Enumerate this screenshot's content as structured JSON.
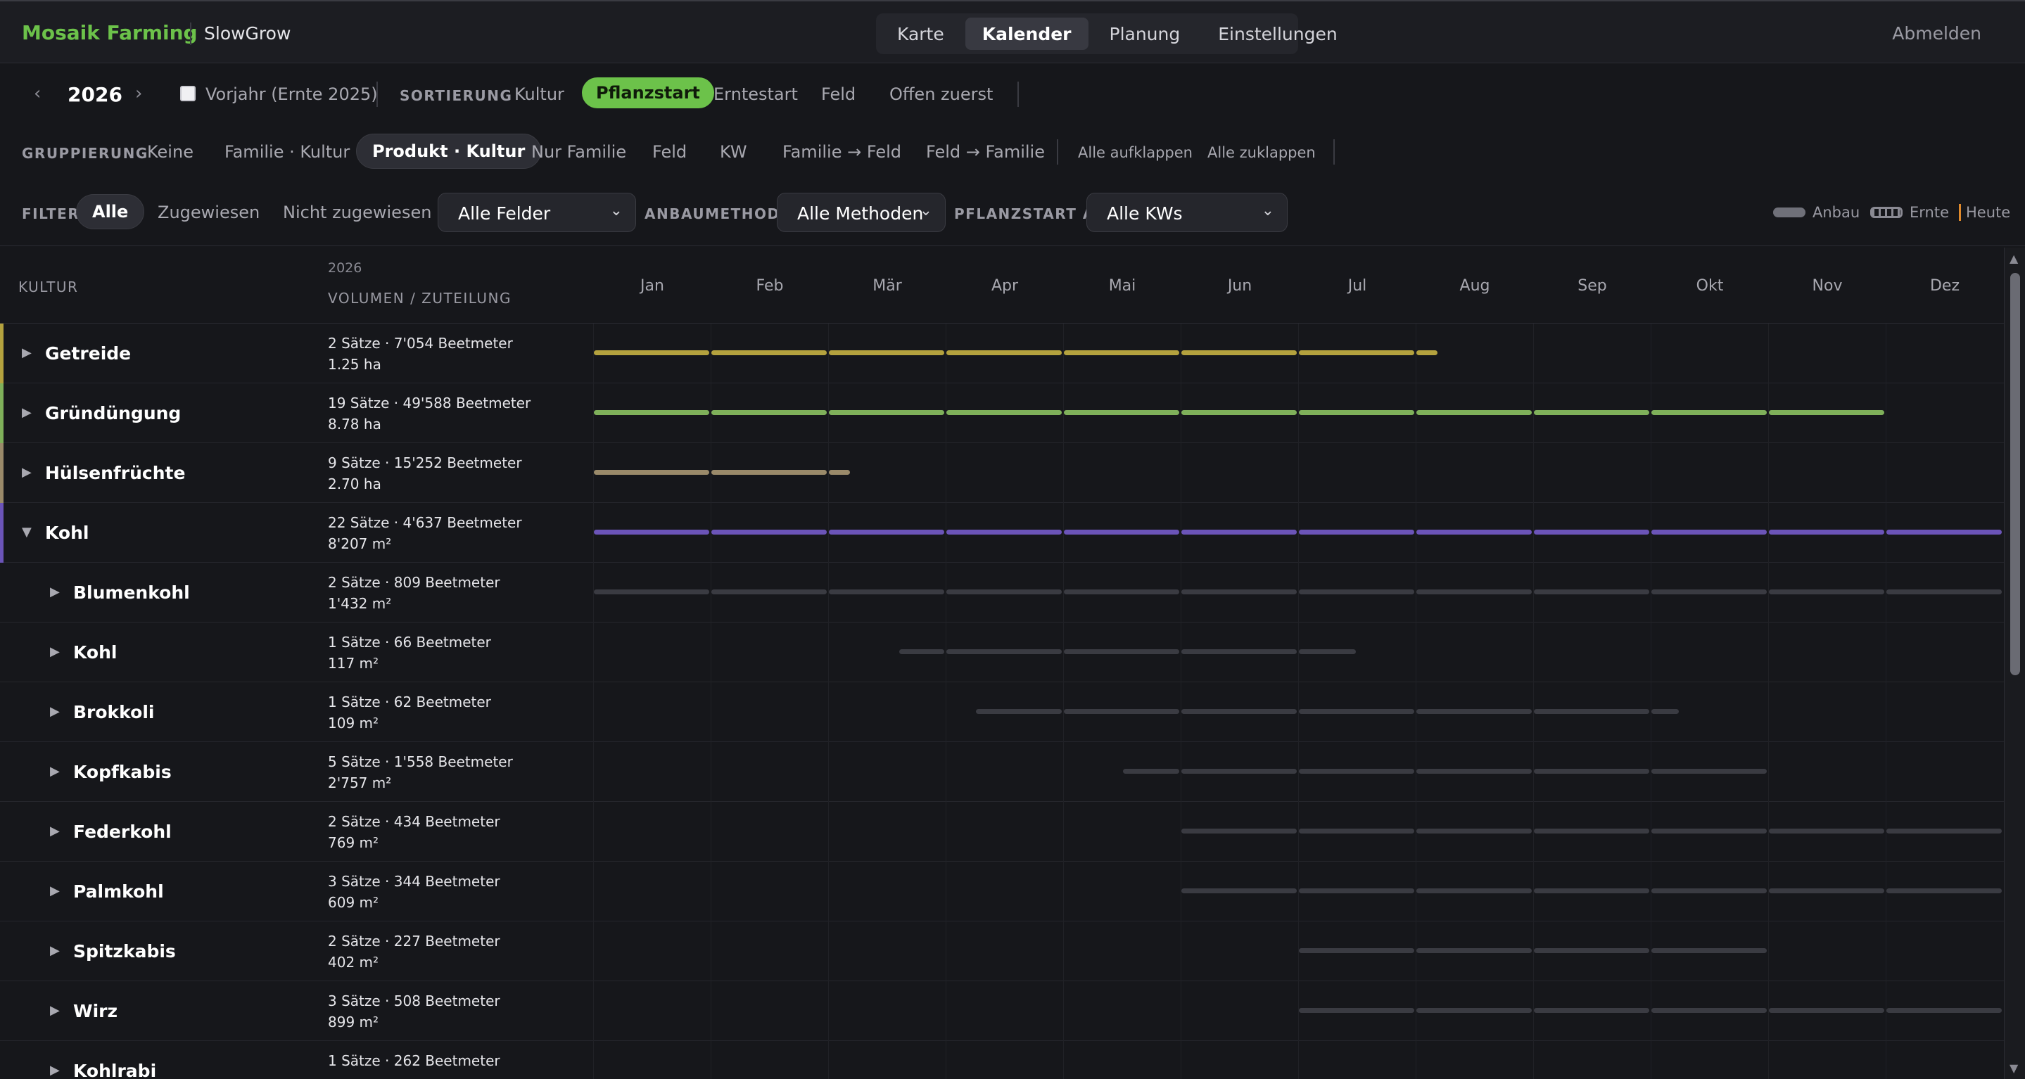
{
  "app": {
    "brand": "Mosaik Farming",
    "farm": "SlowGrow",
    "logout": "Abmelden"
  },
  "nav": {
    "tabs": [
      "Karte",
      "Kalender",
      "Planung",
      "Einstellungen"
    ],
    "active": "Kalender"
  },
  "toolbar": {
    "prev": "‹",
    "year": "2026",
    "next": "›",
    "prev_year_label": "Vorjahr (Ernte 2025)",
    "prev_year_checked": false,
    "sort_label": "SORTIERUNG",
    "sort_options": [
      "Kultur",
      "Pflanzstart",
      "Erntestart",
      "Feld",
      "Offen zuerst"
    ],
    "sort_active": "Pflanzstart",
    "group_label": "GRUPPIERUNG",
    "group_options": [
      "Keine",
      "Familie · Kultur",
      "Produkt · Kultur",
      "Nur Familie",
      "Feld",
      "KW",
      "Familie → Feld",
      "Feld → Familie"
    ],
    "group_active": "Produkt · Kultur",
    "expand_all": "Alle aufklappen",
    "collapse_all": "Alle zuklappen",
    "filter_label": "FILTER",
    "filter_options": [
      "Alle",
      "Zugewiesen",
      "Nicht zugewiesen"
    ],
    "filter_active": "Alle",
    "field_select": "Alle Felder",
    "method_label": "ANBAUMETHODE",
    "method_select": "Alle Methoden",
    "plantstart_label": "PFLANZSTART AB",
    "plantstart_select": "Alle KWs",
    "legend": {
      "anbau": "Anbau",
      "ernte": "Ernte",
      "heute": "Heute"
    }
  },
  "grid": {
    "col_kultur": "KULTUR",
    "col_year": "2026",
    "col_volume": "VOLUMEN / ZUTEILUNG",
    "months": [
      "Jan",
      "Feb",
      "Mär",
      "Apr",
      "Mai",
      "Jun",
      "Jul",
      "Aug",
      "Sep",
      "Okt",
      "Nov",
      "Dez"
    ]
  },
  "colors": {
    "getreide": "#b4a23e",
    "gruenduengung": "#7fb05a",
    "huelsenfruechte": "#9a8a6a",
    "kohl": "#6b54b8",
    "sub": "#3a3b42",
    "brand": "#6cc24a"
  },
  "rows": [
    {
      "name": "Getreide",
      "level": 0,
      "expanded": false,
      "vol1": "2 Sätze · 7'054 Beetmeter",
      "vol2": "1.25 ha",
      "color": "#b4a23e",
      "start": 0,
      "end": 7.2
    },
    {
      "name": "Gründüngung",
      "level": 0,
      "expanded": false,
      "vol1": "19 Sätze · 49'588 Beetmeter",
      "vol2": "8.78 ha",
      "color": "#7fb05a",
      "start": 0,
      "end": 11.0
    },
    {
      "name": "Hülsenfrüchte",
      "level": 0,
      "expanded": false,
      "vol1": "9 Sätze · 15'252 Beetmeter",
      "vol2": "2.70 ha",
      "color": "#9a8a6a",
      "start": 0,
      "end": 2.2
    },
    {
      "name": "Kohl",
      "level": 0,
      "expanded": true,
      "vol1": "22 Sätze · 4'637 Beetmeter",
      "vol2": "8'207 m²",
      "color": "#6b54b8",
      "start": 0,
      "end": 12
    },
    {
      "name": "Blumenkohl",
      "level": 1,
      "expanded": false,
      "vol1": "2 Sätze · 809 Beetmeter",
      "vol2": "1'432 m²",
      "color": "#3a3b42",
      "start": 0,
      "end": 12
    },
    {
      "name": "Kohl",
      "level": 1,
      "expanded": false,
      "vol1": "1 Sätze · 66 Beetmeter",
      "vol2": "117 m²",
      "color": "#3a3b42",
      "start": 2.6,
      "end": 6.5
    },
    {
      "name": "Brokkoli",
      "level": 1,
      "expanded": false,
      "vol1": "1 Sätze · 62 Beetmeter",
      "vol2": "109 m²",
      "color": "#3a3b42",
      "start": 3.25,
      "end": 9.25
    },
    {
      "name": "Kopfkabis",
      "level": 1,
      "expanded": false,
      "vol1": "5 Sätze · 1'558 Beetmeter",
      "vol2": "2'757 m²",
      "color": "#3a3b42",
      "start": 4.5,
      "end": 10.0
    },
    {
      "name": "Federkohl",
      "level": 1,
      "expanded": false,
      "vol1": "2 Sätze · 434 Beetmeter",
      "vol2": "769 m²",
      "color": "#3a3b42",
      "start": 5.0,
      "end": 12
    },
    {
      "name": "Palmkohl",
      "level": 1,
      "expanded": false,
      "vol1": "3 Sätze · 344 Beetmeter",
      "vol2": "609 m²",
      "color": "#3a3b42",
      "start": 5.0,
      "end": 12
    },
    {
      "name": "Spitzkabis",
      "level": 1,
      "expanded": false,
      "vol1": "2 Sätze · 227 Beetmeter",
      "vol2": "402 m²",
      "color": "#3a3b42",
      "start": 6.0,
      "end": 10.0
    },
    {
      "name": "Wirz",
      "level": 1,
      "expanded": false,
      "vol1": "3 Sätze · 508 Beetmeter",
      "vol2": "899 m²",
      "color": "#3a3b42",
      "start": 6.0,
      "end": 12
    },
    {
      "name": "Kohlrabi",
      "level": 1,
      "expanded": false,
      "vol1": "1 Sätze · 262 Beetmeter",
      "vol2": "",
      "color": "#3a3b42",
      "start": 0,
      "end": 0
    }
  ]
}
